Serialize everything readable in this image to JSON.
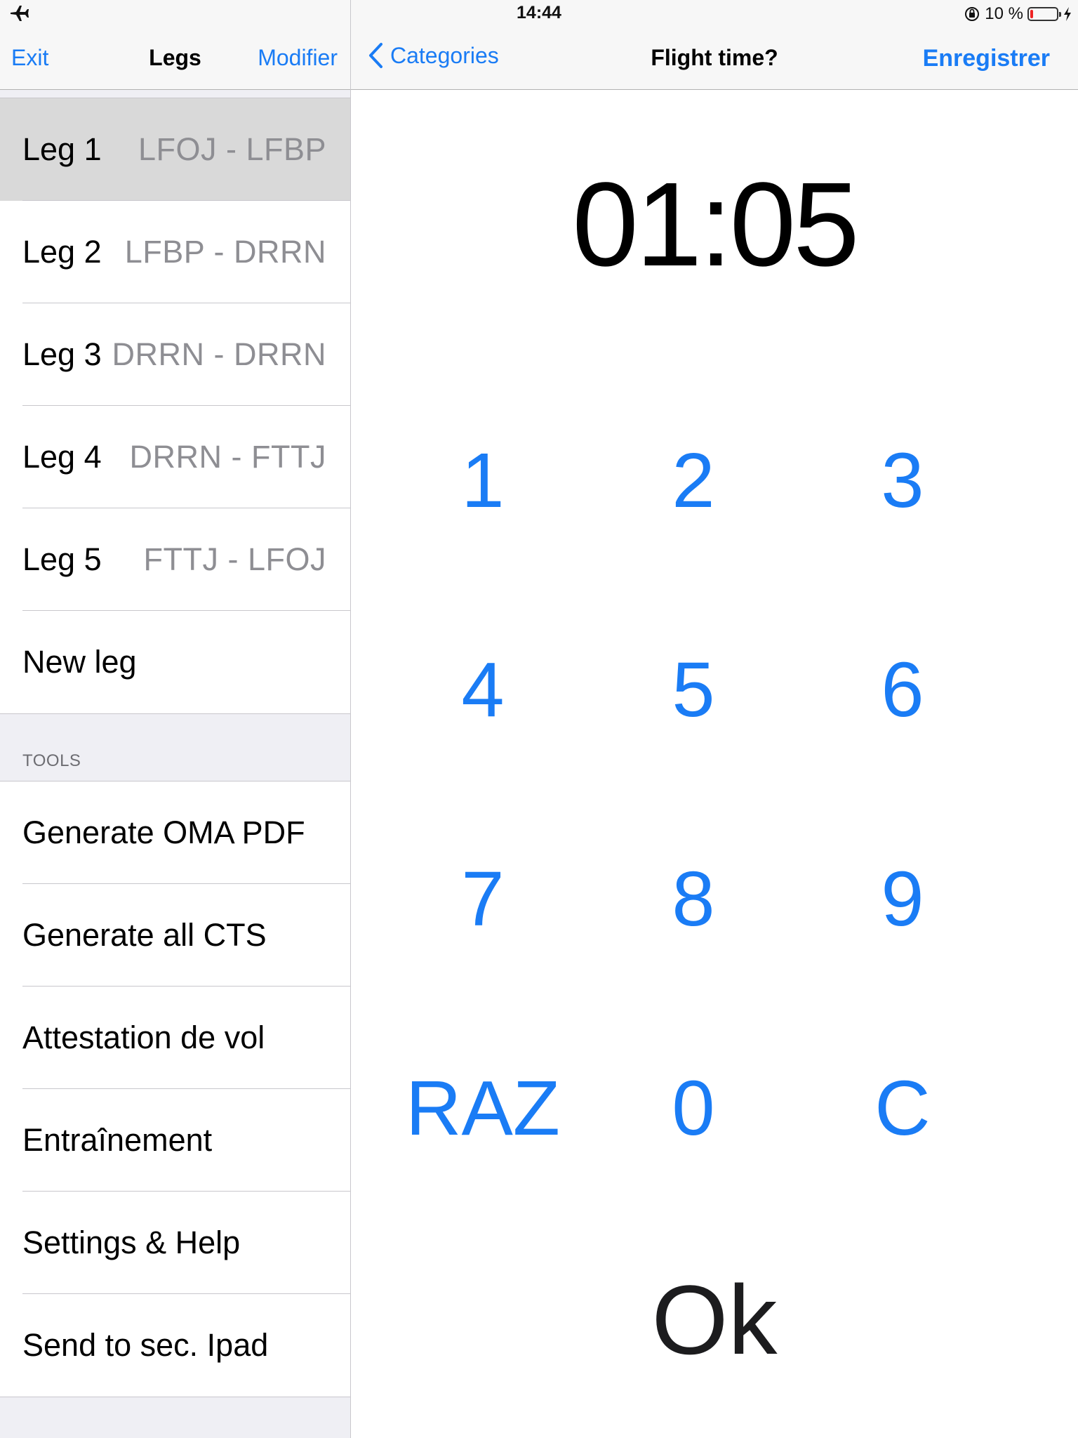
{
  "status_bar": {
    "time": "14:44",
    "battery_text": "10 %",
    "battery_level": 0.1,
    "left_icon": "airplane-mode-icon",
    "right_icons": [
      "orientation-lock-icon",
      "battery-icon",
      "charging-bolt-icon"
    ]
  },
  "master": {
    "nav": {
      "exit_label": "Exit",
      "title": "Legs",
      "edit_label": "Modifier"
    },
    "legs": [
      {
        "title": "Leg 1",
        "route": "LFOJ - LFBP",
        "selected": true
      },
      {
        "title": "Leg 2",
        "route": "LFBP - DRRN",
        "selected": false
      },
      {
        "title": "Leg 3",
        "route": "DRRN - DRRN",
        "selected": false
      },
      {
        "title": "Leg 4",
        "route": "DRRN - FTTJ",
        "selected": false
      },
      {
        "title": "Leg 5",
        "route": "FTTJ - LFOJ",
        "selected": false
      }
    ],
    "new_leg_label": "New leg",
    "tools_header": "TOOLS",
    "tools": [
      {
        "label": "Generate OMA PDF"
      },
      {
        "label": "Generate all CTS"
      },
      {
        "label": "Attestation de vol"
      },
      {
        "label": "Entraînement"
      },
      {
        "label": "Settings & Help"
      },
      {
        "label": "Send to sec. Ipad"
      }
    ]
  },
  "detail": {
    "nav": {
      "back_label": "Categories",
      "title": "Flight time?",
      "save_label": "Enregistrer"
    },
    "time_value": "01:05",
    "keypad": {
      "k1": "1",
      "k2": "2",
      "k3": "3",
      "k4": "4",
      "k5": "5",
      "k6": "6",
      "k7": "7",
      "k8": "8",
      "k9": "9",
      "reset": "RAZ",
      "k0": "0",
      "clear": "C"
    },
    "ok_label": "Ok"
  },
  "colors": {
    "accent": "#1a7cf5",
    "selected_cell": "#d9d9d9",
    "grouped_background": "#efeff4",
    "secondary_text": "#8e8e93",
    "battery_low": "#ee2222"
  }
}
